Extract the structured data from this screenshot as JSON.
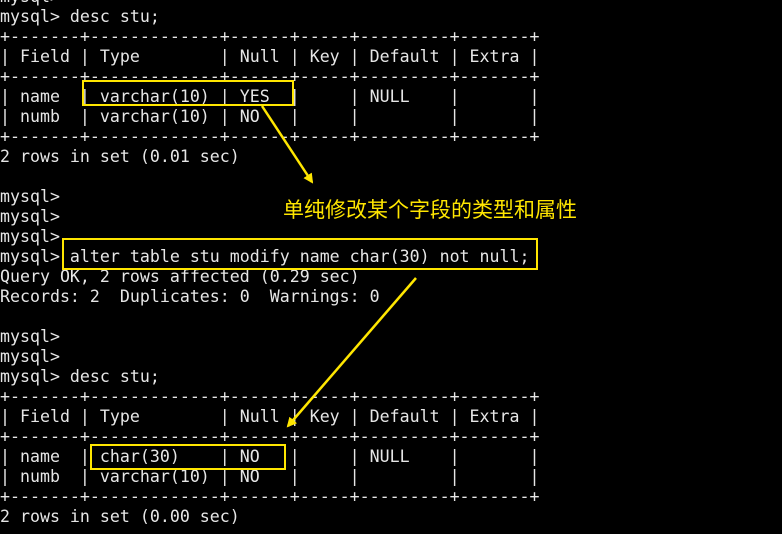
{
  "terminal": {
    "lines": [
      "mysql>",
      "mysql> desc stu;",
      "+-------+-------------+------+-----+---------+-------+",
      "| Field | Type        | Null | Key | Default | Extra |",
      "+-------+-------------+------+-----+---------+-------+",
      "| name  | varchar(10) | YES  |     | NULL    |       |",
      "| numb  | varchar(10) | NO   |     |         |       |",
      "+-------+-------------+------+-----+---------+-------+",
      "2 rows in set (0.01 sec)",
      "",
      "mysql>",
      "mysql>",
      "mysql>",
      "mysql> alter table stu modify name char(30) not null;",
      "Query OK, 2 rows affected (0.29 sec)",
      "Records: 2  Duplicates: 0  Warnings: 0",
      "",
      "mysql>",
      "mysql>",
      "mysql> desc stu;",
      "+-------+-------------+------+-----+---------+-------+",
      "| Field | Type        | Null | Key | Default | Extra |",
      "+-------+-------------+------+-----+---------+-------+",
      "| name  | char(30)    | NO   |     | NULL    |       |",
      "| numb  | varchar(10) | NO   |     |         |       |",
      "+-------+-------------+------+-----+---------+-------+",
      "2 rows in set (0.00 sec)"
    ]
  },
  "annotation": {
    "text": "单纯修改某个字段的类型和属性",
    "color": "#ffe600"
  },
  "colors": {
    "background": "#000000",
    "text": "#e6e6e6",
    "highlight": "#ffe600"
  }
}
